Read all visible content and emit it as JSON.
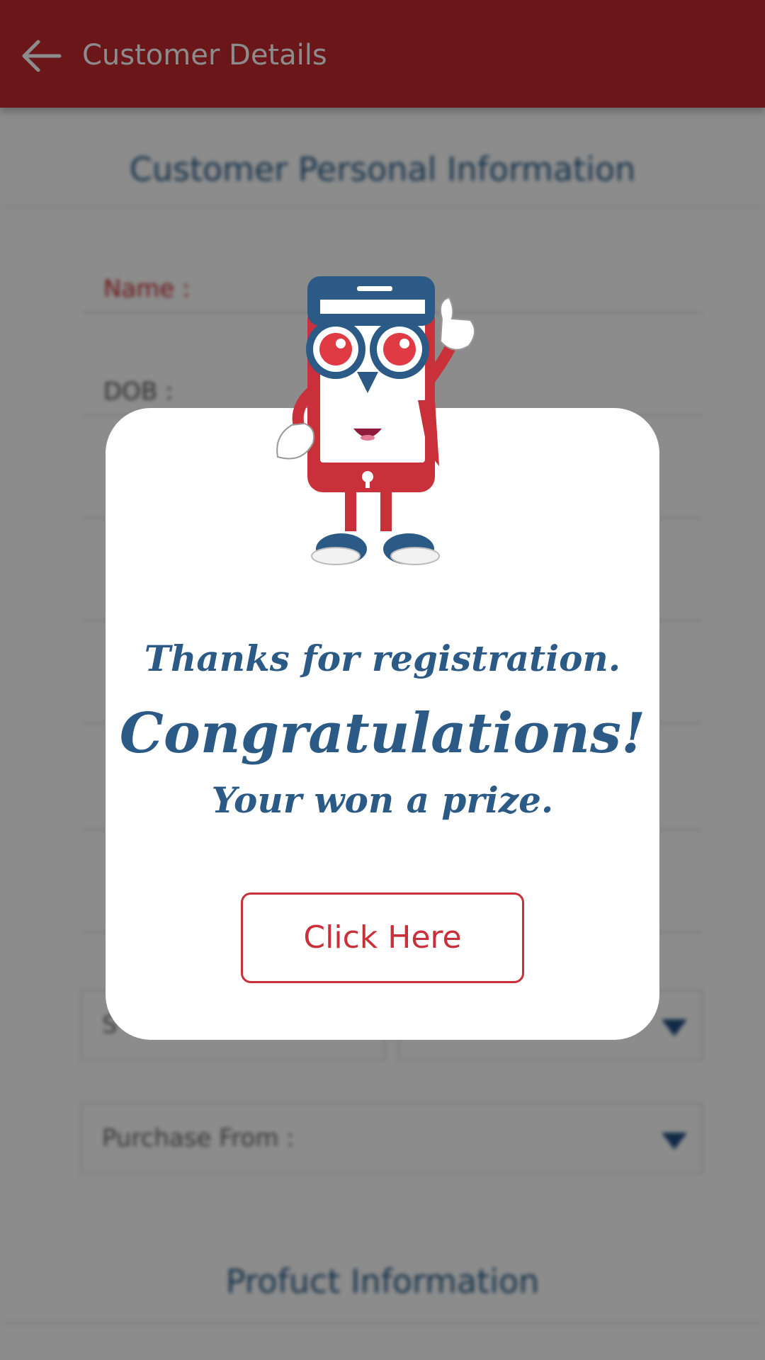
{
  "appbar": {
    "title": "Customer Details"
  },
  "form": {
    "section_title": "Customer Personal Information",
    "fields": [
      {
        "label": "Name :"
      },
      {
        "label": "DOB :"
      }
    ],
    "select_purchase": {
      "label": "Purchase From :"
    },
    "select_state_placeholder": "S"
  },
  "product_section": {
    "title": "Profuct Information"
  },
  "dialog": {
    "thanks": "Thanks for registration.",
    "congrats": "Congratulations!",
    "prize": "Your won a prize.",
    "button_label": "Click Here"
  },
  "colors": {
    "appbar": "#c42a2f",
    "accent_blue": "#2b5a86",
    "button_red": "#c9303a"
  }
}
